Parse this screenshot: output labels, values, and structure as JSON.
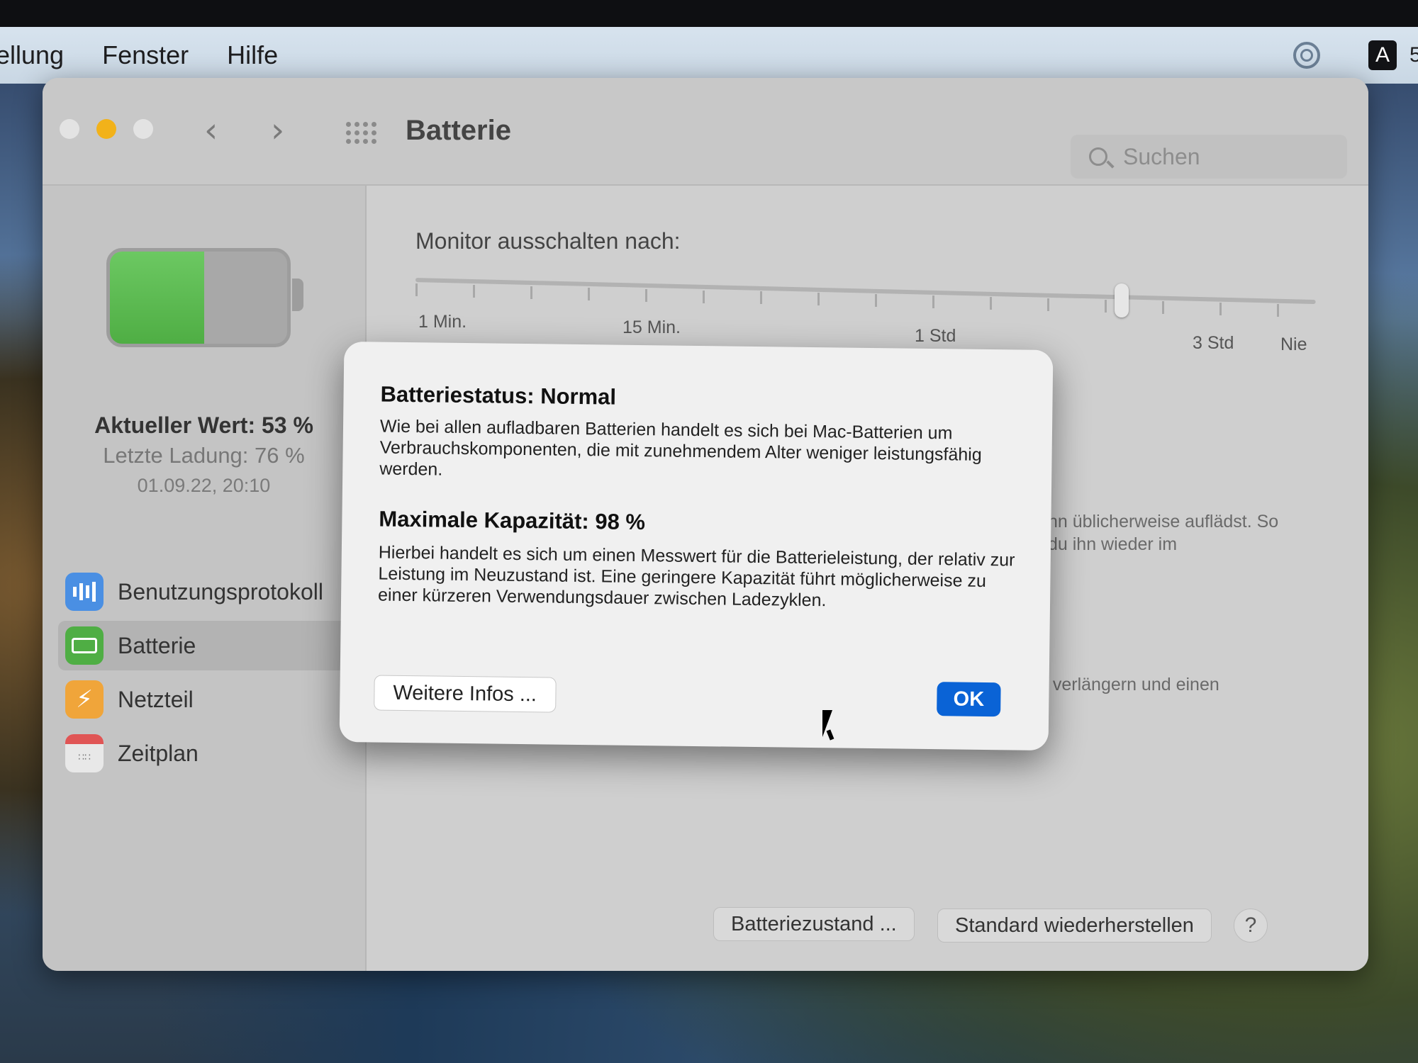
{
  "menubar": {
    "items": [
      "ellung",
      "Fenster",
      "Hilfe"
    ],
    "input_badge": "A",
    "clipped_text": "5"
  },
  "window": {
    "title": "Batterie",
    "search_placeholder": "Suchen"
  },
  "sidebar": {
    "battery_level_percent": 53,
    "current_value": "Aktueller Wert: 53 %",
    "last_charge": "Letzte Ladung: 76 %",
    "last_charge_date": "01.09.22, 20:10",
    "items": [
      {
        "label": "Benutzungsprotokoll",
        "icon": "bar-chart-icon"
      },
      {
        "label": "Batterie",
        "icon": "battery-icon",
        "selected": true
      },
      {
        "label": "Netzteil",
        "icon": "lightning-icon"
      },
      {
        "label": "Zeitplan",
        "icon": "calendar-icon"
      }
    ]
  },
  "main": {
    "monitor_label": "Monitor ausschalten nach:",
    "slider_labels": [
      "1 Min.",
      "15 Min.",
      "1 Std",
      "3 Std",
      "Nie"
    ],
    "bg_text_1": "hn üblicherweise auflädst. So",
    "bg_text_2": "du ihn wieder im",
    "bg_text_3": "u verlängern und einen",
    "battery_health_button": "Batteriezustand ...",
    "restore_defaults_button": "Standard wiederherstellen",
    "help_button": "?"
  },
  "dialog": {
    "heading_status": "Batteriestatus: Normal",
    "body_status": "Wie bei allen aufladbaren Batterien handelt es sich bei Mac-Batterien um Verbrauchskomponenten, die mit zunehmendem Alter weniger leistungsfähig werden.",
    "heading_capacity": "Maximale Kapazität: 98 %",
    "body_capacity": "Hierbei handelt es sich um einen Messwert für die Batterieleistung, der relativ zur Leistung im Neuzustand ist. Eine geringere Kapazität führt möglicherweise zu einer kürzeren Verwendungsdauer zwischen Ladezyklen.",
    "more_info_button": "Weitere Infos ...",
    "ok_button": "OK"
  },
  "colors": {
    "accent": "#0a63d6",
    "battery_green": "#4fae44",
    "minimize_yellow": "#f2b21a"
  }
}
